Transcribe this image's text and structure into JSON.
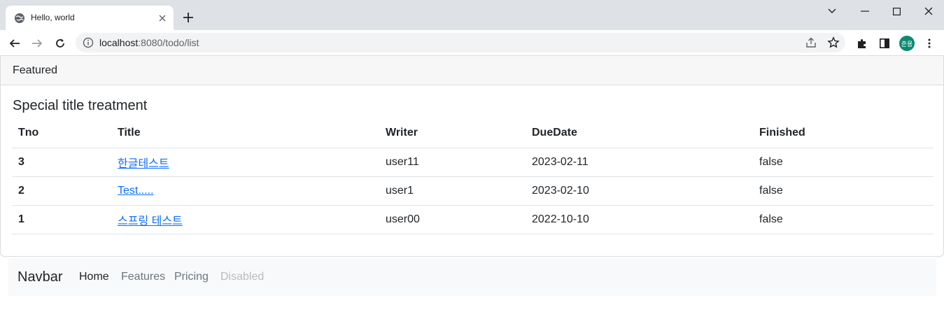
{
  "browser": {
    "tab_title": "Hello, world",
    "url_host": "localhost",
    "url_rest": ":8080/todo/list",
    "avatar_text": "준용",
    "avatar_color": "#0b8a6f"
  },
  "card": {
    "header": "Featured",
    "title": "Special title treatment"
  },
  "table": {
    "columns": [
      "Tno",
      "Title",
      "Writer",
      "DueDate",
      "Finished"
    ],
    "rows": [
      {
        "tno": "3",
        "title": "한글테스트",
        "writer": "user11",
        "duedate": "2023-02-11",
        "finished": "false"
      },
      {
        "tno": "2",
        "title": "Test.....",
        "writer": "user1",
        "duedate": "2023-02-10",
        "finished": "false"
      },
      {
        "tno": "1",
        "title": "스프링 테스트",
        "writer": "user00",
        "duedate": "2022-10-10",
        "finished": "false"
      }
    ]
  },
  "navbar": {
    "brand": "Navbar",
    "links": [
      "Home",
      "Features",
      "Pricing",
      "Disabled"
    ]
  },
  "colors": {
    "link": "#0d6efd",
    "navbar_bg": "#f8f9fa"
  }
}
